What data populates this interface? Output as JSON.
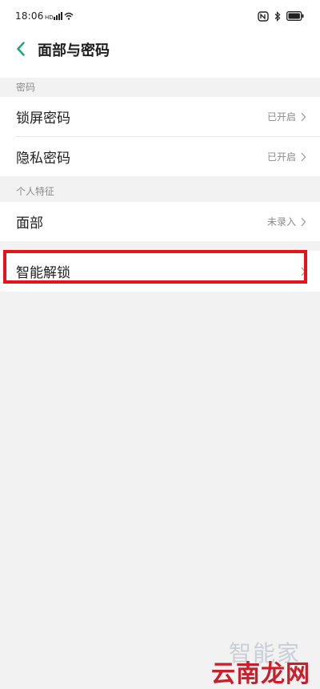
{
  "status_bar": {
    "time": "18:06",
    "icons": [
      "signal-icon",
      "wifi-icon",
      "nfc-icon",
      "bluetooth-icon",
      "battery-icon"
    ]
  },
  "nav": {
    "back_icon": "chevron-left-icon",
    "title": "面部与密码"
  },
  "sections": {
    "password": {
      "header": "密码",
      "items": [
        {
          "label": "锁屏密码",
          "value": "已开启"
        },
        {
          "label": "隐私密码",
          "value": "已开启"
        }
      ]
    },
    "personal": {
      "header": "个人特征",
      "items": [
        {
          "label": "面部",
          "value": "未录入"
        }
      ]
    },
    "unlock": {
      "items": [
        {
          "label": "智能解锁"
        }
      ]
    }
  },
  "watermark": {
    "top": "智能家",
    "bottom": "云南龙网"
  },
  "colors": {
    "accent": "#1aa37a",
    "highlight": "#e8131a",
    "background": "#f2f2f2",
    "watermark_red": "#c8202b"
  }
}
